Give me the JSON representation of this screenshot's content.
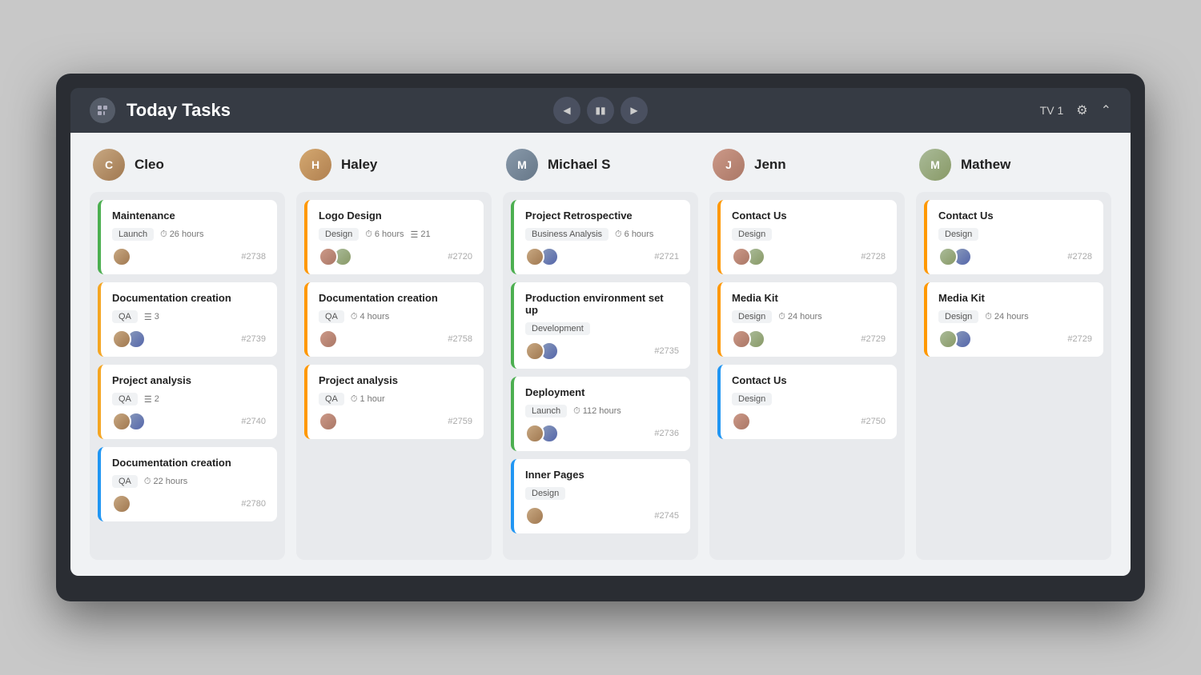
{
  "header": {
    "title": "Today Tasks",
    "tv_label": "TV 1"
  },
  "columns": [
    {
      "id": "cleo",
      "name": "Cleo",
      "avatar_class": "cleo",
      "cards": [
        {
          "title": "Maintenance",
          "border": "green",
          "tag": "Launch",
          "hours": "26 hours",
          "avatars": [
            "a1"
          ],
          "id": "#2738"
        },
        {
          "title": "Documentation creation",
          "border": "yellow",
          "tag": "QA",
          "count": "3",
          "avatars": [
            "a1",
            "a2"
          ],
          "id": "#2739"
        },
        {
          "title": "Project analysis",
          "border": "yellow",
          "tag": "QA",
          "count": "2",
          "avatars": [
            "a1",
            "a2"
          ],
          "id": "#2740"
        },
        {
          "title": "Documentation creation",
          "border": "blue",
          "tag": "QA",
          "hours": "22 hours",
          "avatars": [
            "a1"
          ],
          "id": "#2780"
        }
      ]
    },
    {
      "id": "haley",
      "name": "Haley",
      "avatar_class": "haley",
      "cards": [
        {
          "title": "Logo Design",
          "border": "orange",
          "tag": "Design",
          "hours": "6 hours",
          "count": "21",
          "avatars": [
            "a4",
            "a5"
          ],
          "id": "#2720"
        },
        {
          "title": "Documentation creation",
          "border": "orange",
          "tag": "QA",
          "hours": "4 hours",
          "avatars": [
            "a4"
          ],
          "id": "#2758"
        },
        {
          "title": "Project analysis",
          "border": "orange",
          "tag": "QA",
          "hours": "1 hour",
          "avatars": [
            "a4"
          ],
          "id": "#2759"
        }
      ]
    },
    {
      "id": "michael",
      "name": "Michael S",
      "avatar_class": "michael",
      "cards": [
        {
          "title": "Project Retrospective",
          "border": "green",
          "tag": "Business Analysis",
          "hours": "6 hours",
          "avatars": [
            "a1",
            "a2"
          ],
          "id": "#2721"
        },
        {
          "title": "Production environment set up",
          "border": "green",
          "tag": "Development",
          "avatars": [
            "a1",
            "a2"
          ],
          "id": "#2735"
        },
        {
          "title": "Deployment",
          "border": "green",
          "tag": "Launch",
          "hours": "112 hours",
          "avatars": [
            "a1",
            "a2"
          ],
          "id": "#2736"
        },
        {
          "title": "Inner Pages",
          "border": "blue",
          "tag": "Design",
          "avatars": [
            "a1"
          ],
          "id": "#2745"
        }
      ]
    },
    {
      "id": "jenn",
      "name": "Jenn",
      "avatar_class": "jenn",
      "cards": [
        {
          "title": "Contact Us",
          "border": "orange",
          "tag": "Design",
          "avatars": [
            "a4",
            "a5"
          ],
          "id": "#2728"
        },
        {
          "title": "Media Kit",
          "border": "orange",
          "tag": "Design",
          "hours": "24 hours",
          "avatars": [
            "a4",
            "a5"
          ],
          "id": "#2729"
        },
        {
          "title": "Contact Us",
          "border": "blue",
          "tag": "Design",
          "avatars": [
            "a4"
          ],
          "id": "#2750"
        }
      ]
    },
    {
      "id": "mathew",
      "name": "Mathew",
      "avatar_class": "mathew",
      "cards": [
        {
          "title": "Contact Us",
          "border": "orange",
          "tag": "Design",
          "avatars": [
            "a5",
            "a2"
          ],
          "id": "#2728"
        },
        {
          "title": "Media Kit",
          "border": "orange",
          "tag": "Design",
          "hours": "24 hours",
          "avatars": [
            "a5",
            "a2"
          ],
          "id": "#2729"
        }
      ]
    }
  ]
}
